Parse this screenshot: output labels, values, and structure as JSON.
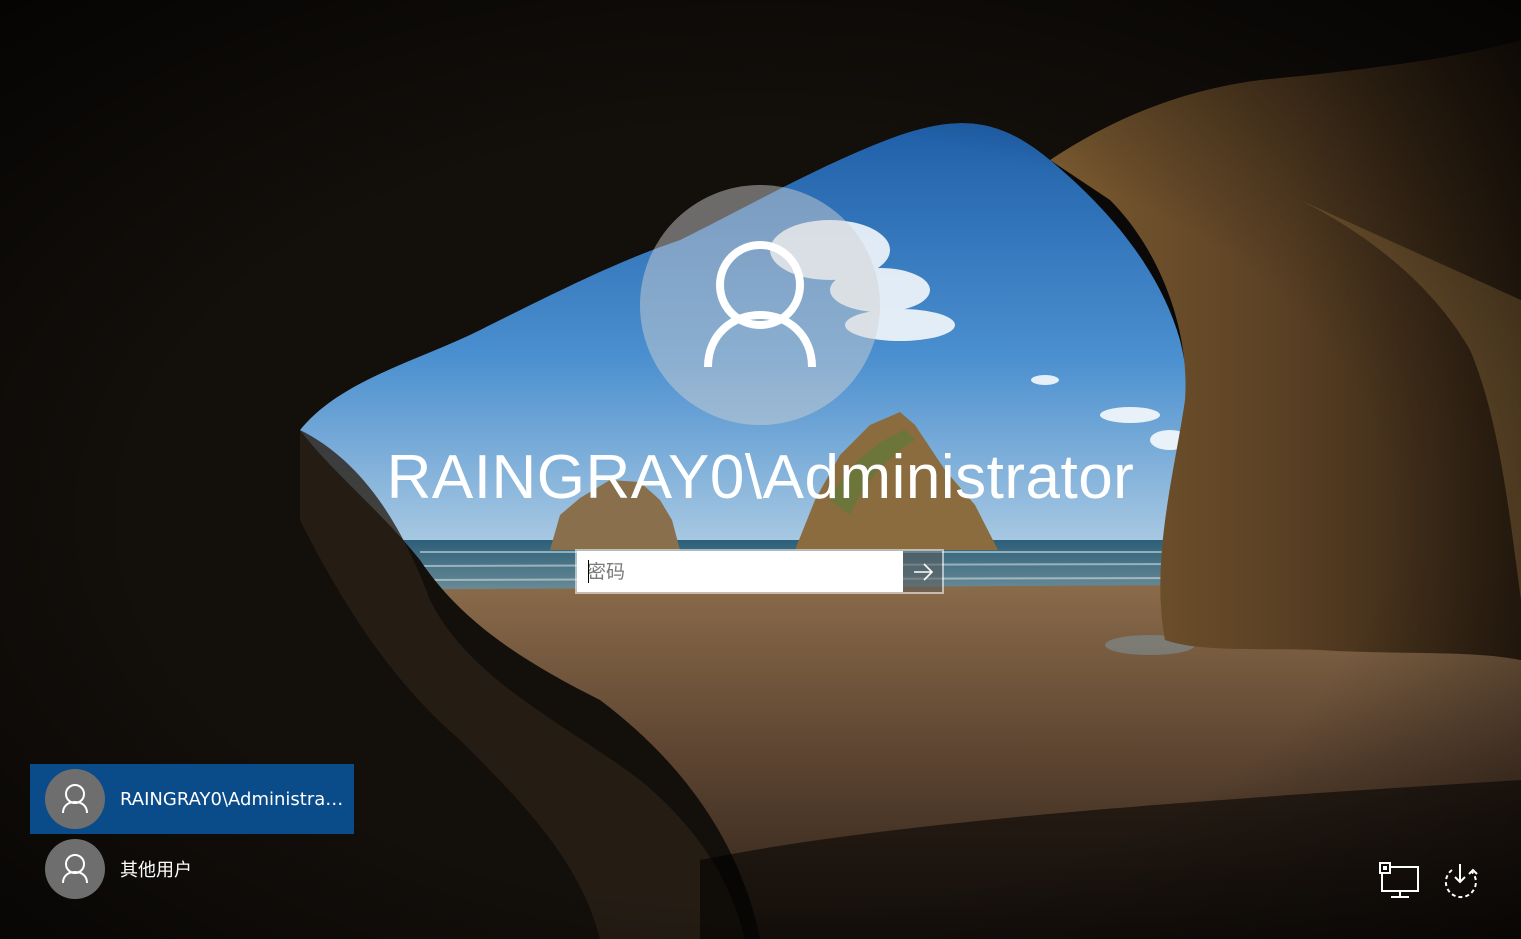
{
  "login": {
    "username": "RAINGRAY0\\Administrator",
    "password_placeholder": "密码",
    "password_value": "",
    "submit_icon": "arrow-right-icon",
    "avatar_icon": "user-icon"
  },
  "user_list": [
    {
      "label": "RAINGRAY0\\Administrator",
      "selected": true,
      "icon": "user-icon"
    },
    {
      "label": "其他用户",
      "selected": false,
      "icon": "user-icon"
    }
  ],
  "corner_controls": {
    "network_icon": "network-display-icon",
    "power_icon": "power-icon"
  },
  "colors": {
    "selected_tile": "#0a4b8a",
    "avatar_circle": "#6e6e6e",
    "text": "#ffffff"
  }
}
